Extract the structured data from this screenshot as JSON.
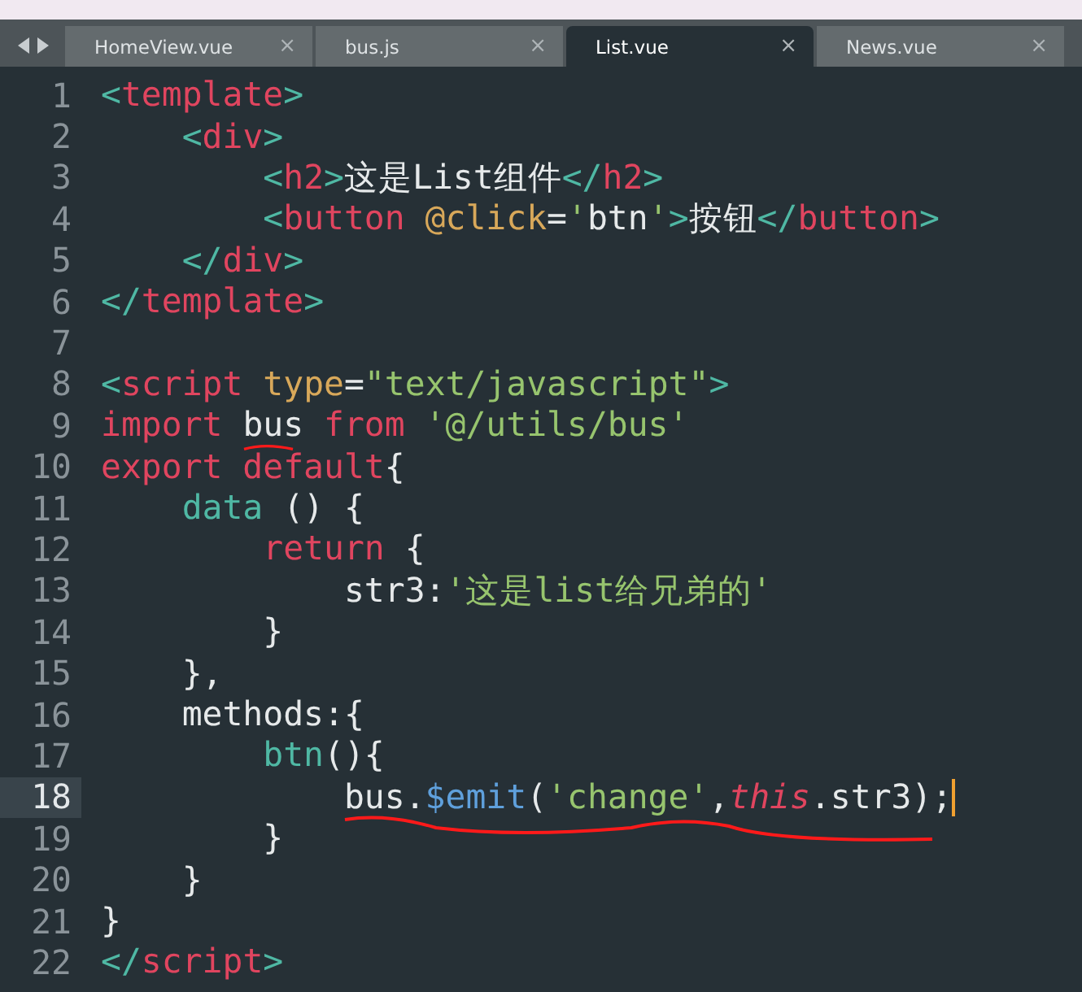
{
  "tabs": [
    {
      "label": "HomeView.vue",
      "selected": false,
      "close": "×"
    },
    {
      "label": "bus.js",
      "selected": false,
      "close": "×"
    },
    {
      "label": "List.vue",
      "selected": true,
      "close": "×"
    },
    {
      "label": "News.vue",
      "selected": false,
      "close": "×"
    }
  ],
  "lines": [
    {
      "number": "1",
      "current": false,
      "tokens": [
        {
          "kind": "punct",
          "text": "<"
        },
        {
          "kind": "tag",
          "text": "template"
        },
        {
          "kind": "punct",
          "text": ">"
        }
      ]
    },
    {
      "number": "2",
      "current": false,
      "tokens": [
        {
          "kind": "punct",
          "text": "    <"
        },
        {
          "kind": "tag",
          "text": "div"
        },
        {
          "kind": "punct",
          "text": ">"
        }
      ]
    },
    {
      "number": "3",
      "current": false,
      "tokens": [
        {
          "kind": "punct",
          "text": "        <"
        },
        {
          "kind": "tag",
          "text": "h2"
        },
        {
          "kind": "punct",
          "text": ">"
        },
        {
          "kind": "plain",
          "text": "这是List组件"
        },
        {
          "kind": "punct",
          "text": "</"
        },
        {
          "kind": "tag",
          "text": "h2"
        },
        {
          "kind": "punct",
          "text": ">"
        }
      ]
    },
    {
      "number": "4",
      "current": false,
      "tokens": [
        {
          "kind": "punct",
          "text": "        <"
        },
        {
          "kind": "tag",
          "text": "button"
        },
        {
          "kind": "attr",
          "text": " @click"
        },
        {
          "kind": "plain",
          "text": "="
        },
        {
          "kind": "string",
          "text": "'"
        },
        {
          "kind": "plain",
          "text": "btn"
        },
        {
          "kind": "string",
          "text": "'"
        },
        {
          "kind": "punct",
          "text": ">"
        },
        {
          "kind": "plain",
          "text": "按钮"
        },
        {
          "kind": "punct",
          "text": "</"
        },
        {
          "kind": "tag",
          "text": "button"
        },
        {
          "kind": "punct",
          "text": ">"
        }
      ]
    },
    {
      "number": "5",
      "current": false,
      "tokens": [
        {
          "kind": "punct",
          "text": "    </"
        },
        {
          "kind": "tag",
          "text": "div"
        },
        {
          "kind": "punct",
          "text": ">"
        }
      ]
    },
    {
      "number": "6",
      "current": false,
      "tokens": [
        {
          "kind": "punct",
          "text": "</"
        },
        {
          "kind": "tag",
          "text": "template"
        },
        {
          "kind": "punct",
          "text": ">"
        }
      ]
    },
    {
      "number": "7",
      "current": false
    },
    {
      "number": "8",
      "current": false,
      "tokens": [
        {
          "kind": "punct",
          "text": "<"
        },
        {
          "kind": "tag",
          "text": "script"
        },
        {
          "kind": "attr",
          "text": " type"
        },
        {
          "kind": "plain",
          "text": "="
        },
        {
          "kind": "string",
          "text": "\"text/javascript\""
        },
        {
          "kind": "punct",
          "text": ">"
        }
      ]
    },
    {
      "number": "9",
      "current": false,
      "tokens": [
        {
          "kind": "keyword",
          "text": "import"
        },
        {
          "kind": "plain",
          "text": " bus "
        },
        {
          "kind": "keyword",
          "text": "from"
        },
        {
          "kind": "string",
          "text": " '@/utils/bus'"
        }
      ]
    },
    {
      "number": "10",
      "current": false,
      "tokens": [
        {
          "kind": "keyword",
          "text": "export default"
        },
        {
          "kind": "plain",
          "text": "{"
        }
      ]
    },
    {
      "number": "11",
      "current": false,
      "tokens": [
        {
          "kind": "func",
          "text": "    data"
        },
        {
          "kind": "plain",
          "text": " () {"
        }
      ]
    },
    {
      "number": "12",
      "current": false,
      "tokens": [
        {
          "kind": "keyword",
          "text": "        return"
        },
        {
          "kind": "plain",
          "text": " {"
        }
      ]
    },
    {
      "number": "13",
      "current": false,
      "tokens": [
        {
          "kind": "plain",
          "text": "            str3:"
        },
        {
          "kind": "string",
          "text": "'这是list给兄弟的'"
        }
      ]
    },
    {
      "number": "14",
      "current": false,
      "tokens": [
        {
          "kind": "plain",
          "text": "        }"
        }
      ]
    },
    {
      "number": "15",
      "current": false,
      "tokens": [
        {
          "kind": "plain",
          "text": "    },"
        }
      ]
    },
    {
      "number": "16",
      "current": false,
      "tokens": [
        {
          "kind": "plain",
          "text": "    methods:{"
        }
      ]
    },
    {
      "number": "17",
      "current": false,
      "tokens": [
        {
          "kind": "func",
          "text": "        btn"
        },
        {
          "kind": "plain",
          "text": "(){"
        }
      ]
    },
    {
      "number": "18",
      "current": true,
      "tokens": [
        {
          "kind": "plain",
          "text": "            bus."
        },
        {
          "kind": "method",
          "text": "$emit"
        },
        {
          "kind": "plain",
          "text": "("
        },
        {
          "kind": "string",
          "text": "'change'"
        },
        {
          "kind": "this",
          "text": ",this"
        },
        {
          "kind": "plain",
          "text": ".str3);"
        }
      ]
    },
    {
      "number": "19",
      "current": false,
      "tokens": [
        {
          "kind": "plain",
          "text": "        }"
        }
      ]
    },
    {
      "number": "20",
      "current": false,
      "tokens": [
        {
          "kind": "plain",
          "text": "    }"
        }
      ]
    },
    {
      "number": "21",
      "current": false,
      "tokens": [
        {
          "kind": "plain",
          "text": "}"
        }
      ]
    },
    {
      "number": "22",
      "current": false,
      "tokens": [
        {
          "kind": "punct",
          "text": "</"
        },
        {
          "kind": "tag",
          "text": "script"
        },
        {
          "kind": "punct",
          "text": ">"
        }
      ]
    }
  ]
}
